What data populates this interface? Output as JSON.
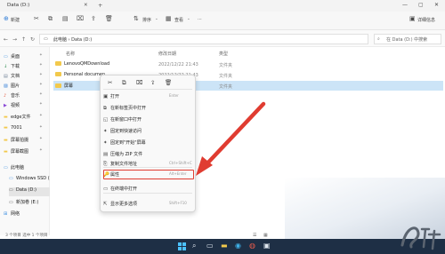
{
  "window": {
    "tab_title": "Data (D:)",
    "tab_close": "✕",
    "new_tab": "+",
    "controls": [
      "—",
      "▢",
      "✕"
    ]
  },
  "toolbar": {
    "new_label": "新建",
    "sort_label": "排序",
    "view_label": "查看",
    "more": "···",
    "details_label": "详细信息"
  },
  "address": {
    "path": "此电脑 › Data (D:)",
    "search_placeholder": "在 Data (D:) 中搜索"
  },
  "sidebar": {
    "items": [
      {
        "label": "桌面",
        "icon": "desktop-icon",
        "color": "#3b8ee0"
      },
      {
        "label": "下载",
        "icon": "download-icon",
        "color": "#2c8c4d"
      },
      {
        "label": "文档",
        "icon": "document-icon",
        "color": "#6b7d93"
      },
      {
        "label": "图片",
        "icon": "picture-icon",
        "color": "#2d7bd6"
      },
      {
        "label": "音乐",
        "icon": "music-icon",
        "color": "#e0472b"
      },
      {
        "label": "视频",
        "icon": "video-icon",
        "color": "#8a4ad6"
      },
      {
        "label": "edge文件",
        "icon": "folder-icon",
        "color": "#f2c94c"
      },
      {
        "label": "7001",
        "icon": "folder-icon",
        "color": "#f2c94c"
      },
      {
        "label": "屏幕拍摄",
        "icon": "folder-icon",
        "color": "#f2c94c"
      },
      {
        "label": "屏幕截图",
        "icon": "folder-icon",
        "color": "#f2c94c"
      },
      {
        "label": "此电脑",
        "icon": "computer-icon",
        "color": "#3b8ee0"
      },
      {
        "label": "Windows SSD (",
        "icon": "drive-icon",
        "color": "#3b8ee0"
      },
      {
        "label": "Data (D:)",
        "icon": "drive-icon",
        "color": "#555"
      },
      {
        "label": "新加卷 (E:)",
        "icon": "drive-icon",
        "color": "#555"
      },
      {
        "label": "网络",
        "icon": "network-icon",
        "color": "#3b8ee0"
      }
    ]
  },
  "files": {
    "columns": [
      "名称",
      "修改日期",
      "类型"
    ],
    "rows": [
      {
        "name": "LenovoQMDownload",
        "date": "2022/12/22 21:43",
        "type": "文件夹"
      },
      {
        "name": "Personal documen",
        "date": "2022/12/22 21:43",
        "type": "文件夹"
      },
      {
        "name": "屏幕",
        "date": "",
        "type": "文件夹"
      }
    ]
  },
  "status": "3 个项目  选中 1 个项目",
  "context_menu": {
    "top_icons": [
      "cut-icon",
      "copy-icon",
      "rename-icon",
      "share-icon",
      "delete-icon"
    ],
    "items": [
      {
        "icon": "open-icon",
        "label": "打开",
        "shortcut": "Enter"
      },
      {
        "icon": "new-tab-icon",
        "label": "在新标签页中打开",
        "shortcut": ""
      },
      {
        "icon": "new-window-icon",
        "label": "在新窗口中打开",
        "shortcut": ""
      },
      {
        "icon": "pin-quick-access-icon",
        "label": "固定到快速访问",
        "shortcut": ""
      },
      {
        "icon": "pin-start-icon",
        "label": "固定到\"开始\"屏幕",
        "shortcut": ""
      },
      {
        "icon": "zip-icon",
        "label": "压缩为 ZIP 文件",
        "shortcut": ""
      },
      {
        "icon": "copy-path-icon",
        "label": "复制文件地址",
        "shortcut": "Ctrl+Shift+C"
      },
      {
        "icon": "properties-icon",
        "label": "属性",
        "shortcut": "Alt+Enter"
      },
      {
        "icon": "terminal-icon",
        "label": "在终端中打开",
        "shortcut": ""
      },
      {
        "icon": "more-options-icon",
        "label": "显示更多选项",
        "shortcut": "Shift+F10"
      }
    ]
  },
  "colors": {
    "highlight": "#e03c31",
    "selection": "#cce4f7",
    "taskbar": "#1e2f45"
  }
}
